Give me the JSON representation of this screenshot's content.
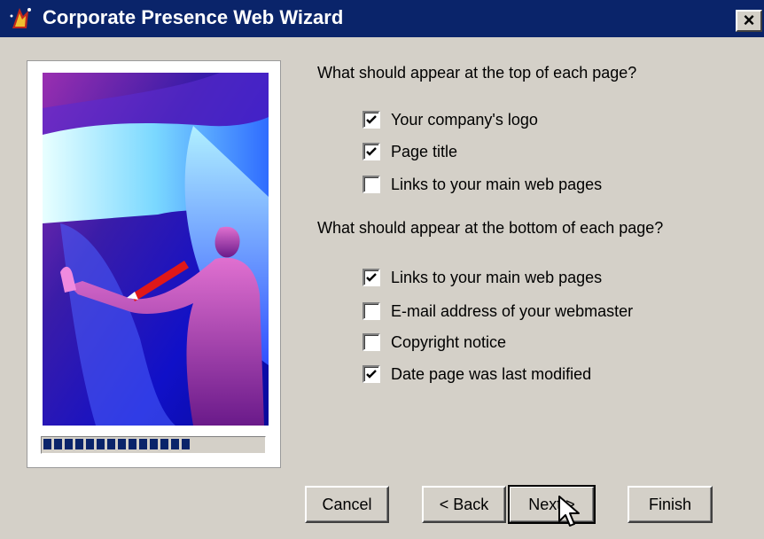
{
  "window": {
    "title": "Corporate Presence Web Wizard",
    "app_icon": "wizard-hat-icon",
    "close_label": "×"
  },
  "progress": {
    "fraction": 0.68
  },
  "top_section": {
    "question": "What should appear at the top of each page?",
    "options": [
      {
        "label": "Your company's logo",
        "checked": true
      },
      {
        "label": "Page title",
        "checked": true
      },
      {
        "label": "Links to your main web pages",
        "checked": false
      }
    ]
  },
  "bottom_section": {
    "question": "What should appear at the bottom of each page?",
    "options": [
      {
        "label": "Links to your main web pages",
        "checked": true
      },
      {
        "label": "E-mail address of your webmaster",
        "checked": false
      },
      {
        "label": "Copyright notice",
        "checked": false
      },
      {
        "label": "Date page was last modified",
        "checked": true
      }
    ]
  },
  "buttons": {
    "cancel": "Cancel",
    "back": "< Back",
    "next": "Next >",
    "finish": "Finish"
  }
}
